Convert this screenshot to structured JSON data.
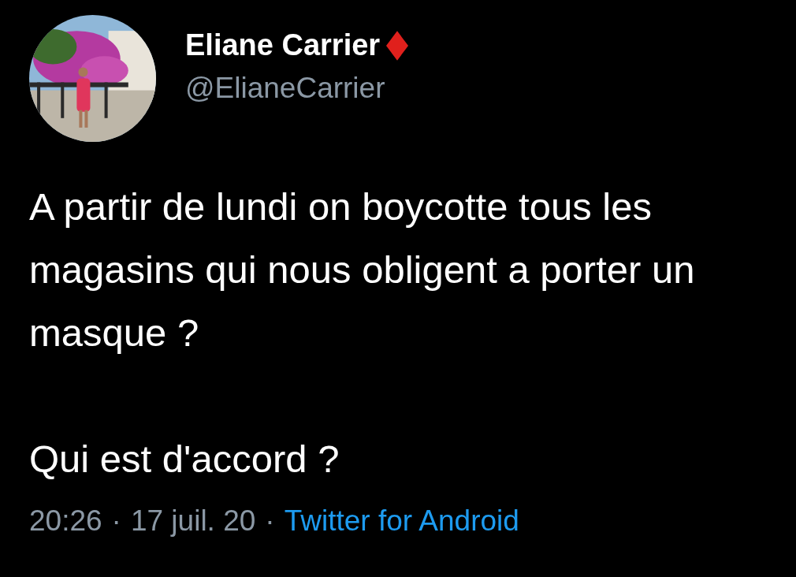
{
  "author": {
    "name": "Eliane Carrier",
    "handle": "@ElianeCarrier"
  },
  "tweet": {
    "paragraphs": [
      "A partir de lundi on boycotte tous les magasins qui nous obligent a porter un masque ?",
      "Qui est d'accord ?"
    ]
  },
  "footer": [
    {
      "kind": "text",
      "text": "20:26"
    },
    {
      "kind": "separator",
      "text": "·"
    },
    {
      "kind": "text",
      "text": "17 juil. 20"
    },
    {
      "kind": "separator",
      "text": "·"
    },
    {
      "kind": "link",
      "text": "Twitter for Android"
    }
  ]
}
